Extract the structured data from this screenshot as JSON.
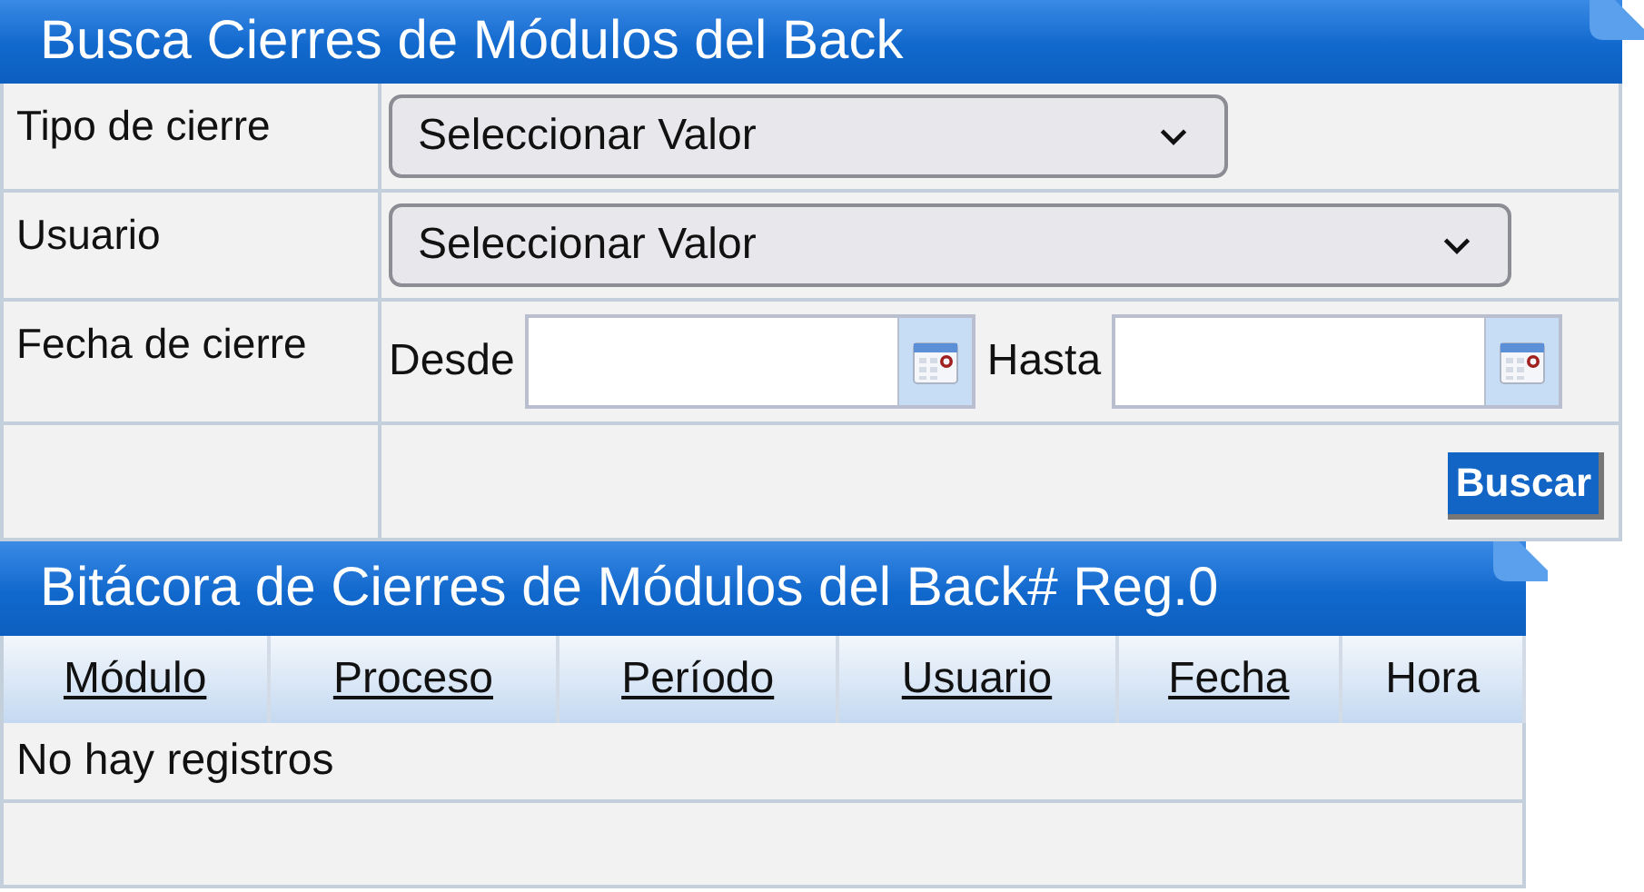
{
  "search_panel": {
    "title": "Busca Cierres de Módulos del Back",
    "fields": [
      {
        "kind": "select",
        "label": "Tipo de cierre",
        "value": "Seleccionar Valor"
      },
      {
        "kind": "select",
        "label": "Usuario",
        "value": "Seleccionar Valor"
      },
      {
        "kind": "daterange",
        "label": "Fecha de cierre",
        "from_label": "Desde",
        "to_label": "Hasta"
      }
    ],
    "button": "Buscar"
  },
  "log_panel": {
    "title": "Bitácora de Cierres de Módulos del Back# Reg.0",
    "columns": [
      {
        "label": "Módulo",
        "kind": "link"
      },
      {
        "label": "Proceso",
        "kind": "link"
      },
      {
        "label": "Período",
        "kind": "link"
      },
      {
        "label": "Usuario",
        "kind": "link"
      },
      {
        "label": "Fecha",
        "kind": "link"
      },
      {
        "label": "Hora",
        "kind": "text"
      }
    ],
    "empty_message": "No hay registros"
  }
}
